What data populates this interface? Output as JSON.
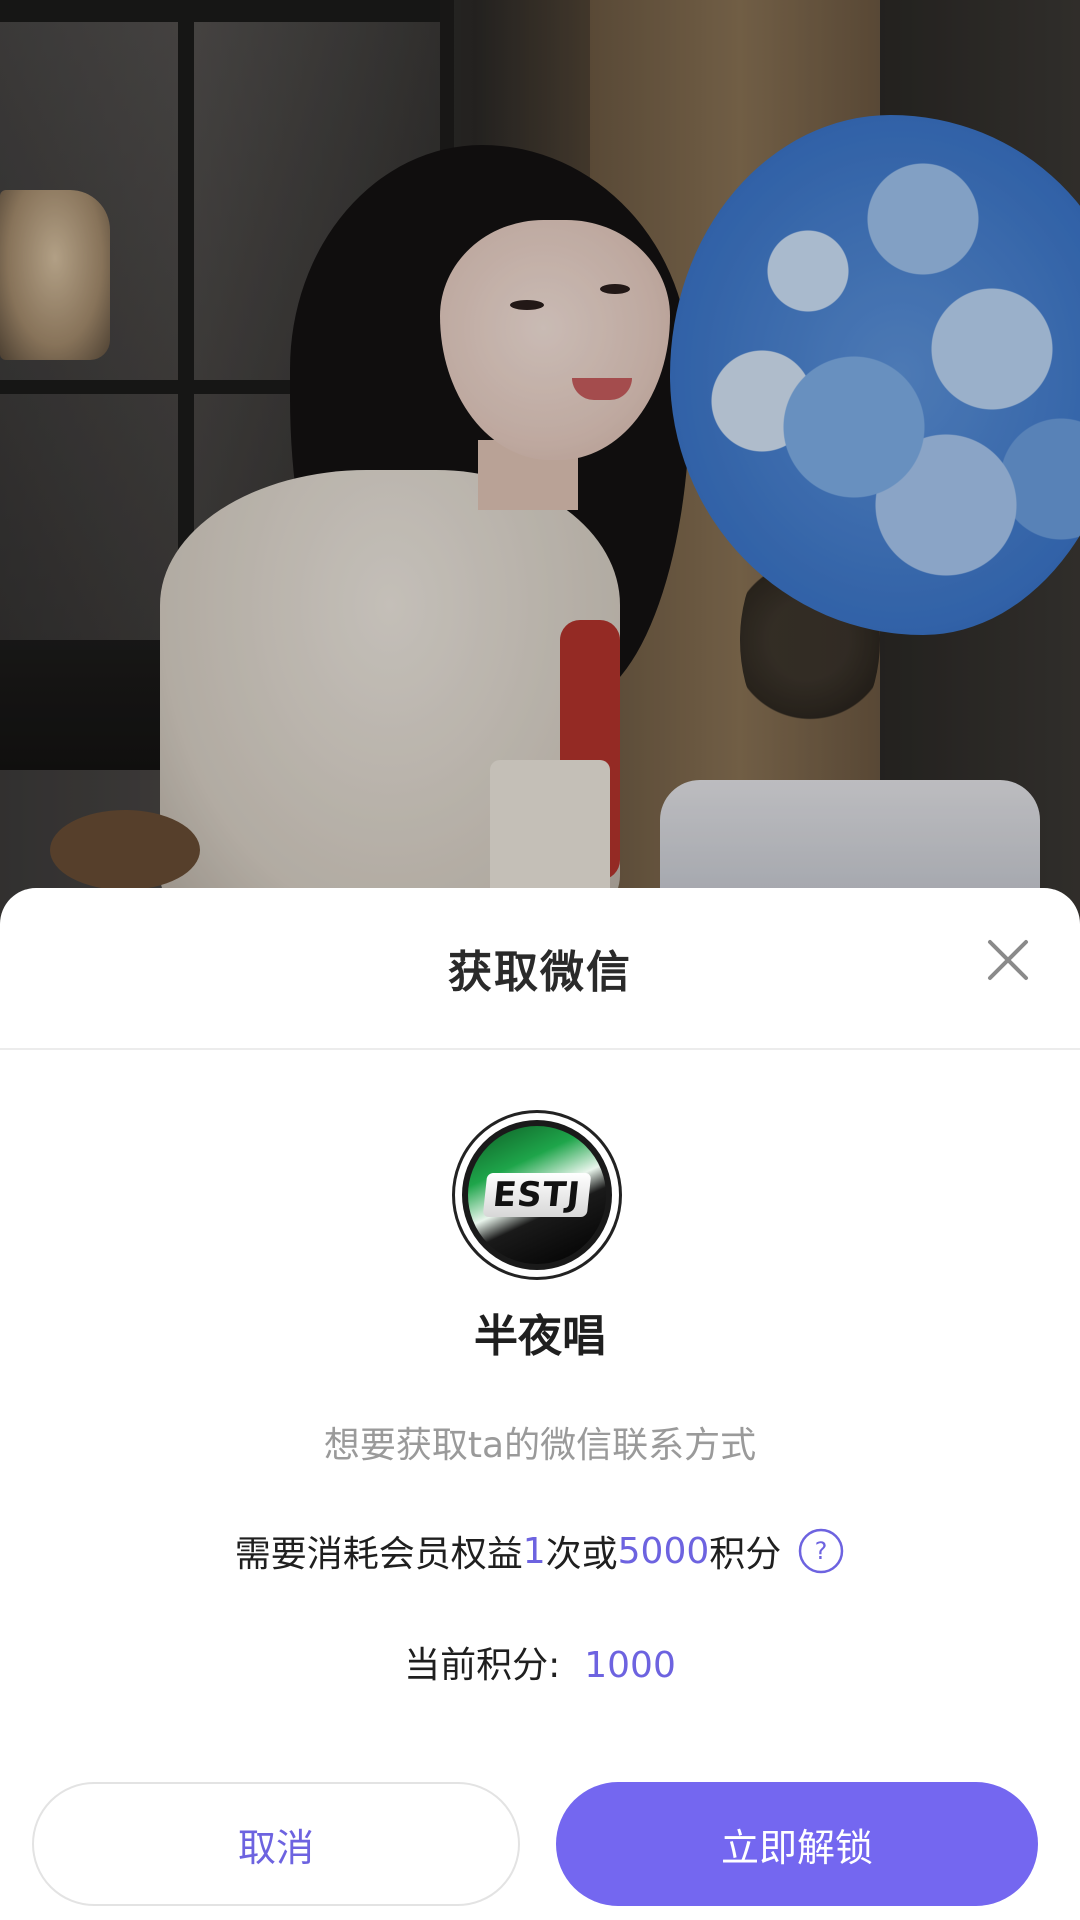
{
  "sheet": {
    "title": "获取微信",
    "close_icon": "close-icon"
  },
  "profile": {
    "avatar_text": "ESTJ",
    "nickname": "半夜唱"
  },
  "message": {
    "subtitle": "想要获取ta的微信联系方式",
    "cost_prefix": "需要消耗会员权益",
    "cost_times": "1",
    "cost_middle": "次或",
    "cost_points": "5000",
    "cost_suffix": "积分",
    "help_icon": "question-circle-icon",
    "help_glyph": "?",
    "points_label": "当前积分:",
    "points_value": "1000"
  },
  "actions": {
    "cancel_label": "取消",
    "unlock_label": "立即解锁"
  },
  "colors": {
    "accent": "#6d63e0",
    "primary_button": "#7467f0",
    "sheet_bg": "#ffffff"
  }
}
